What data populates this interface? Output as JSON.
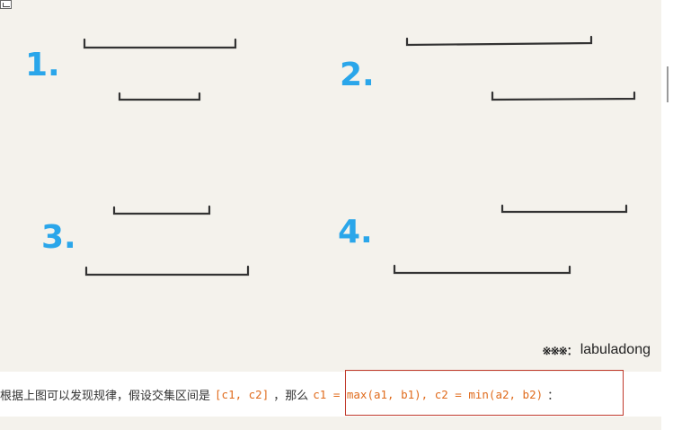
{
  "figure": {
    "cases": [
      "1.",
      "2.",
      "3.",
      "4."
    ],
    "watermark": {
      "mark": "※※※：",
      "author": "labuladong"
    }
  },
  "text": {
    "prefix": "根据上图可以发现规律，假设交集区间是",
    "interval": "[c1, c2]",
    "middle": "，那么",
    "formula": "c1 = max(a1, b1), c2 = min(a2, b2)",
    "suffix": "："
  },
  "colors": {
    "case_number": "#2aa6ea",
    "code": "#e06b1c",
    "highlight": "#c0392b",
    "figure_bg": "#f4f2ec"
  }
}
